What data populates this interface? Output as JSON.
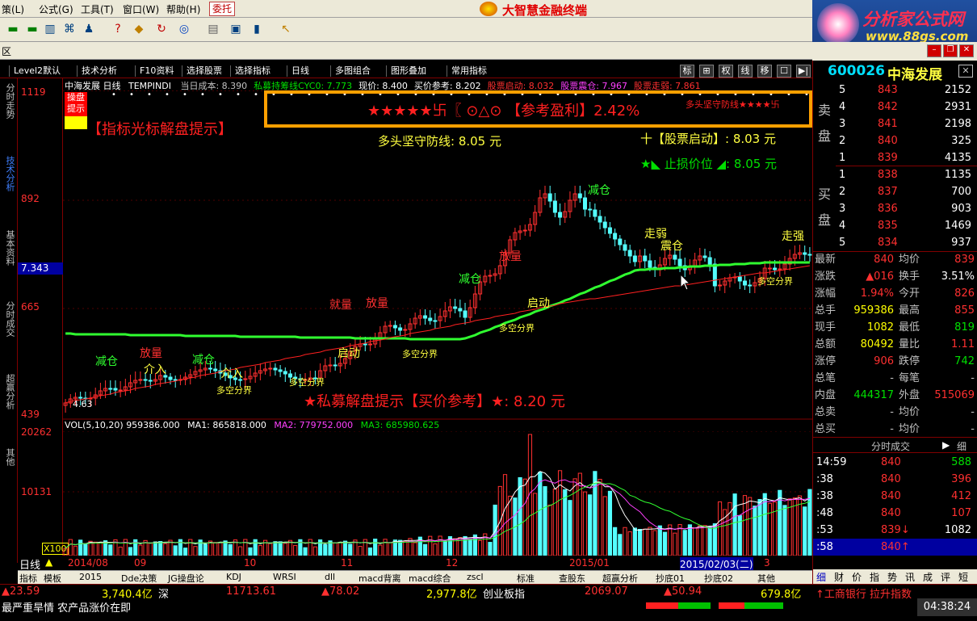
{
  "menubar": {
    "items": [
      "策(L)",
      "公式(G)",
      "工具(T)",
      "窗口(W)",
      "帮助(H)"
    ],
    "order_button": "委托",
    "title": "大智慧金融终端"
  },
  "ad": {
    "title": "分析家公式网",
    "url": "www.88gs.com"
  },
  "row52": {
    "label": "区"
  },
  "tabs": [
    "Level2默认",
    "技术分析",
    "F10资料",
    "选择股票",
    "选择指标",
    "日线",
    "多图组合",
    "图形叠加",
    "常用指标"
  ],
  "tab_right_buttons": [
    "标",
    "⊞",
    "权",
    "线",
    "移",
    "☐",
    "▶|"
  ],
  "leftbar": [
    "分时走势",
    "技术分析",
    "基本资料",
    "分时成交",
    "超赢分析",
    "其他"
  ],
  "axis": {
    "labels": [
      "1119",
      "892",
      "665",
      "439"
    ],
    "cursor_value": "7.343",
    "vol_labels": [
      "20262",
      "10131"
    ],
    "vol_unit": "X100"
  },
  "chartinfo": {
    "name": "中海发展",
    "period": "日线",
    "indicator": "TEMPINDI",
    "fields": [
      {
        "text": "当日成本: 8.390",
        "color": "#c0c0c0"
      },
      {
        "text": "私募持筹线CYC0: 7.773",
        "color": "#00e000"
      },
      {
        "text": "现价: 8.400",
        "color": "#ffffff"
      },
      {
        "text": "买价参考: 8.202",
        "color": "#ffffff"
      },
      {
        "text": "股票启动: 8.032",
        "color": "#ff3030"
      },
      {
        "text": "股票震仓: 7.967",
        "color": "#ff40ff"
      },
      {
        "text": "股票走弱: 7.861",
        "color": "#ff3030"
      }
    ]
  },
  "volinfo": {
    "label": "VOL(5,10,20)",
    "value": "959386.000",
    "ma1": "MA1: 865818.000",
    "ma2": "MA2: 779752.000",
    "ma3": "MA3: 685980.625"
  },
  "overlays": {
    "box_text": "★★★★★卐〖 ⊙△⊙ 【参考盈利】2.42%",
    "box_tail": "多头坚守防线★★★★卐",
    "cursor_hint": "【指标光标解盘提示】",
    "cursor_badge": "操盘提示",
    "bull_defense": "多头坚守防线: 8.05 元",
    "start_label": "十【股票启动】: 8.03 元",
    "stoploss_label": "★◣ 止损价位 ◢: 8.05 元",
    "bottom_hint": "★私募解盘提示【买价参考】★: 8.20 元",
    "low_marker": "4.63"
  },
  "chart_data": {
    "type": "candlestick",
    "y_axis": {
      "ticks": [
        "1119",
        "892",
        "665",
        "439"
      ],
      "min": 439,
      "max": 1119
    },
    "x_ticks": [
      "2014/08",
      "09",
      "10",
      "11",
      "12",
      "2015/01",
      "2015/02/03(二)",
      "3"
    ],
    "annotations": [
      "减仓",
      "介入",
      "多空分界",
      "放量",
      "启动",
      "走弱",
      "震仓",
      "私募"
    ],
    "volume": {
      "ticks": [
        "20262",
        "10131"
      ],
      "max": 20262
    }
  },
  "timeaxis": {
    "period": "日线",
    "labels": [
      "2014/08",
      "09",
      "10",
      "11",
      "12",
      "2015/01",
      "2015/02/03(二)",
      "3"
    ]
  },
  "bottomtabs": [
    "指标",
    "模板",
    "2015",
    "Dde决策",
    "JG操盘论",
    "KDJ",
    "WRSI",
    "dll",
    "macd背离",
    "macd综合",
    "zscl",
    "标准",
    "查股东",
    "超赢分析",
    "抄底01",
    "抄底02",
    "其他"
  ],
  "right": {
    "code": "600026",
    "name": "中海发展",
    "sell": [
      {
        "lvl": "5",
        "price": "843",
        "vol": "2152"
      },
      {
        "lvl": "4",
        "price": "842",
        "vol": "2931"
      },
      {
        "lvl": "3",
        "price": "841",
        "vol": "2198"
      },
      {
        "lvl": "2",
        "price": "840",
        "vol": "325"
      },
      {
        "lvl": "1",
        "price": "839",
        "vol": "4135"
      }
    ],
    "buy": [
      {
        "lvl": "1",
        "price": "838",
        "vol": "1135"
      },
      {
        "lvl": "2",
        "price": "837",
        "vol": "700"
      },
      {
        "lvl": "3",
        "price": "836",
        "vol": "903"
      },
      {
        "lvl": "4",
        "price": "835",
        "vol": "1469"
      },
      {
        "lvl": "5",
        "price": "834",
        "vol": "937"
      }
    ],
    "sell_label": "卖盘",
    "buy_label": "买盘",
    "stats": [
      {
        "k1": "最新",
        "v1": "840",
        "c1": "#ff3030",
        "k2": "均价",
        "v2": "839",
        "c2": "#ff3030"
      },
      {
        "k1": "涨跌",
        "v1": "▲016",
        "c1": "#ff3030",
        "k2": "换手",
        "v2": "3.51%",
        "c2": "#ffffff"
      },
      {
        "k1": "涨幅",
        "v1": "1.94%",
        "c1": "#ff3030",
        "k2": "今开",
        "v2": "826",
        "c2": "#ff3030"
      },
      {
        "k1": "总手",
        "v1": "959386",
        "c1": "#ffff00",
        "k2": "最高",
        "v2": "855",
        "c2": "#ff3030"
      },
      {
        "k1": "现手",
        "v1": "1082",
        "c1": "#ffff00",
        "k2": "最低",
        "v2": "819",
        "c2": "#00e000"
      },
      {
        "k1": "总额",
        "v1": "80492",
        "c1": "#ffff00",
        "k2": "量比",
        "v2": "1.11",
        "c2": "#ff3030"
      },
      {
        "k1": "涨停",
        "v1": "906",
        "c1": "#ff3030",
        "k2": "跌停",
        "v2": "742",
        "c2": "#00e000"
      },
      {
        "k1": "总笔",
        "v1": "-",
        "c1": "#c0c0c0",
        "k2": "每笔",
        "v2": "-",
        "c2": "#c0c0c0"
      },
      {
        "k1": "内盘",
        "v1": "444317",
        "c1": "#00e000",
        "k2": "外盘",
        "v2": "515069",
        "c2": "#ff3030"
      },
      {
        "k1": "总卖",
        "v1": "-",
        "c1": "#c0c0c0",
        "k2": "均价",
        "v2": "-",
        "c2": "#c0c0c0"
      },
      {
        "k1": "总买",
        "v1": "-",
        "c1": "#c0c0c0",
        "k2": "均价",
        "v2": "-",
        "c2": "#c0c0c0"
      }
    ],
    "ticks_title": "分时成交",
    "ticks_btn": "细",
    "ticks": [
      {
        "t": "14:59",
        "p": "840",
        "v": "588",
        "vc": "#00e000"
      },
      {
        "t": ":38",
        "p": "840",
        "v": "396",
        "vc": "#ff3030"
      },
      {
        "t": ":38",
        "p": "840",
        "v": "412",
        "vc": "#ff3030"
      },
      {
        "t": ":48",
        "p": "840",
        "v": "107",
        "vc": "#ff3030"
      },
      {
        "t": ":53",
        "p": "839↓",
        "v": "1082",
        "vc": "#ffffff"
      },
      {
        "t": ":58",
        "p": "840↑",
        "v": "",
        "vc": "#ffffff"
      }
    ],
    "bottom_tabs": [
      "细",
      "财",
      "价",
      "指",
      "势",
      "讯",
      "成",
      "评",
      "短"
    ]
  },
  "status1": {
    "items": [
      {
        "text": "▲23.59",
        "color": "#ff3030"
      },
      {
        "text": "3,740.4亿",
        "color": "#ffff00"
      },
      {
        "text": "深",
        "color": "#ffffff"
      },
      {
        "text": "11713.61",
        "color": "#ff3030"
      },
      {
        "text": "▲78.02",
        "color": "#ff3030"
      },
      {
        "text": "2,977.8亿",
        "color": "#ffff00"
      },
      {
        "text": "创业板指",
        "color": "#ffffff"
      },
      {
        "text": "2069.07",
        "color": "#ff3030"
      },
      {
        "text": "▲50.94",
        "color": "#ff3030"
      },
      {
        "text": "679.8亿",
        "color": "#ffff00"
      },
      {
        "text": "↑工商银行 拉升指数",
        "color": "#ff3030"
      }
    ]
  },
  "status2": {
    "news": "最严重旱情 农产品涨价在即",
    "clock": "04:38:24"
  }
}
